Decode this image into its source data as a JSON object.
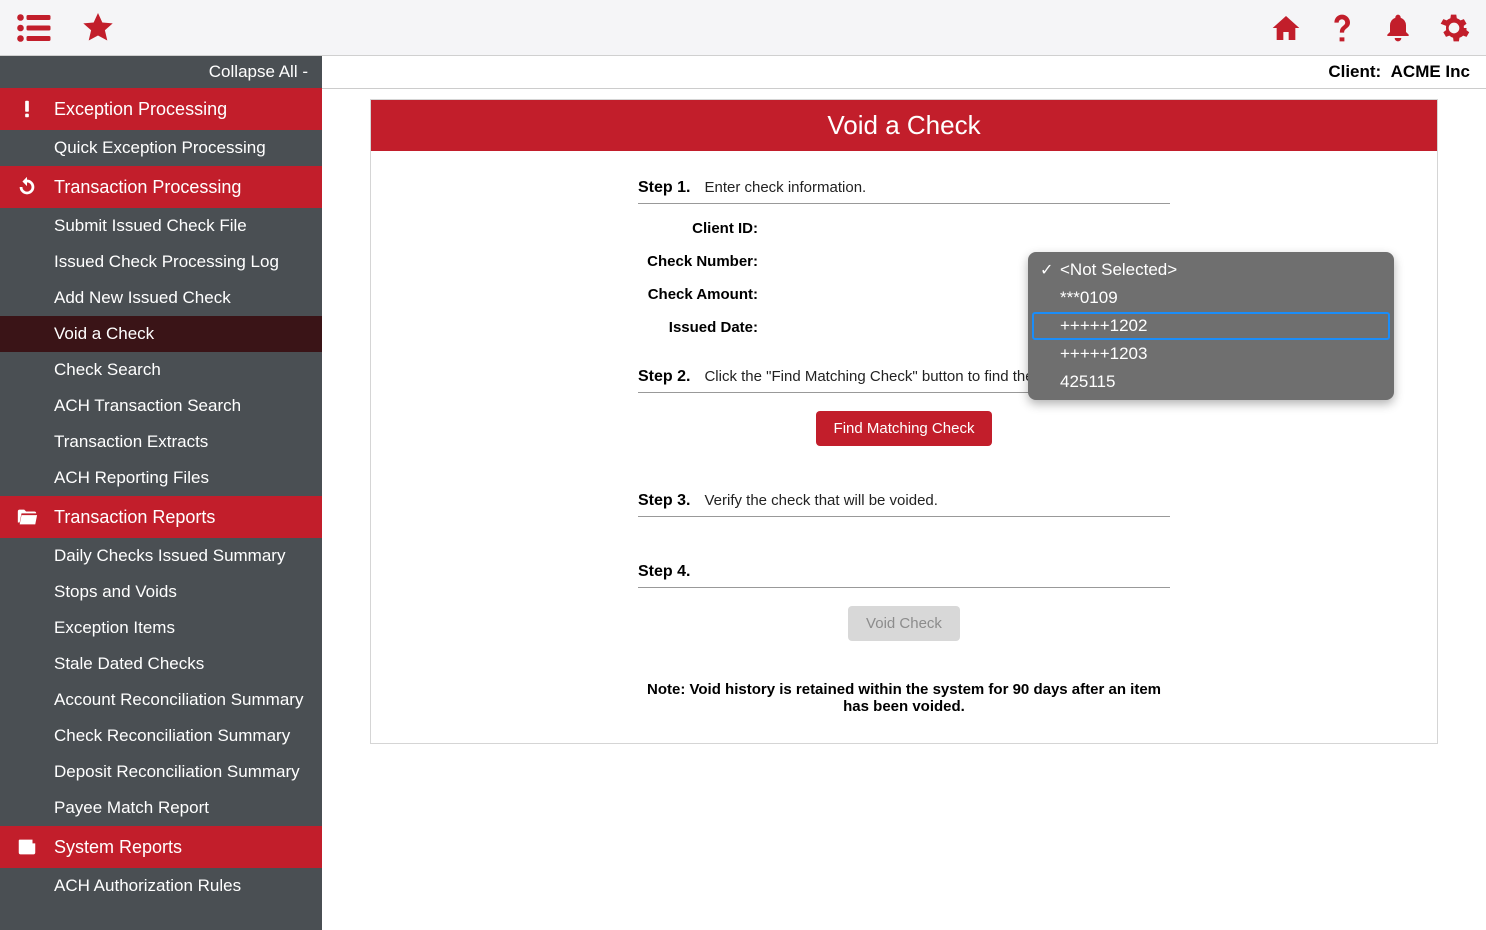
{
  "topbar": {
    "icons": {
      "menu": "menu-list-icon",
      "star": "star-icon",
      "home": "home-icon",
      "help": "help-icon",
      "bell": "bell-icon",
      "gear": "gear-icon"
    }
  },
  "client_label": "Client:",
  "client_name": "ACME Inc",
  "sidebar": {
    "collapse_label": "Collapse All -",
    "sections": [
      {
        "label": "Exception Processing",
        "icon": "exclamation-icon",
        "items": [
          {
            "label": "Quick Exception Processing"
          }
        ]
      },
      {
        "label": "Transaction Processing",
        "icon": "refresh-icon",
        "items": [
          {
            "label": "Submit Issued Check File"
          },
          {
            "label": "Issued Check Processing Log"
          },
          {
            "label": "Add New Issued Check"
          },
          {
            "label": "Void a Check",
            "active": true
          },
          {
            "label": "Check Search"
          },
          {
            "label": "ACH Transaction Search"
          },
          {
            "label": "Transaction Extracts"
          },
          {
            "label": "ACH Reporting Files"
          }
        ]
      },
      {
        "label": "Transaction Reports",
        "icon": "folder-open-icon",
        "items": [
          {
            "label": "Daily Checks Issued Summary"
          },
          {
            "label": "Stops and Voids"
          },
          {
            "label": "Exception Items"
          },
          {
            "label": "Stale Dated Checks"
          },
          {
            "label": "Account Reconciliation Summary"
          },
          {
            "label": "Check Reconciliation Summary"
          },
          {
            "label": "Deposit Reconciliation Summary"
          },
          {
            "label": "Payee Match Report"
          }
        ]
      },
      {
        "label": "System Reports",
        "icon": "newspaper-icon",
        "items": [
          {
            "label": "ACH Authorization Rules"
          }
        ]
      }
    ]
  },
  "panel": {
    "title": "Void a Check",
    "steps": {
      "s1": {
        "label": "Step 1.",
        "text": "Enter check information."
      },
      "s2": {
        "label": "Step 2.",
        "text": "Click the \"Find Matching Check\" button to find the check."
      },
      "s3": {
        "label": "Step 3.",
        "text": "Verify the check that will be voided."
      },
      "s4": {
        "label": "Step 4.",
        "text": ""
      }
    },
    "form": {
      "client_id_label": "Client ID:",
      "check_number_label": "Check Number:",
      "check_amount_label": "Check Amount:",
      "issued_date_label": "Issued Date:"
    },
    "buttons": {
      "find": "Find Matching Check",
      "void": "Void Check"
    },
    "note": "Note: Void history is retained within the system for 90 days after an item has been voided."
  },
  "dropdown": {
    "options": [
      {
        "label": "<Not Selected>",
        "checked": true
      },
      {
        "label": "***0109"
      },
      {
        "label": "+++++1202",
        "highlight": true
      },
      {
        "label": "+++++1203"
      },
      {
        "label": "425115"
      }
    ]
  }
}
